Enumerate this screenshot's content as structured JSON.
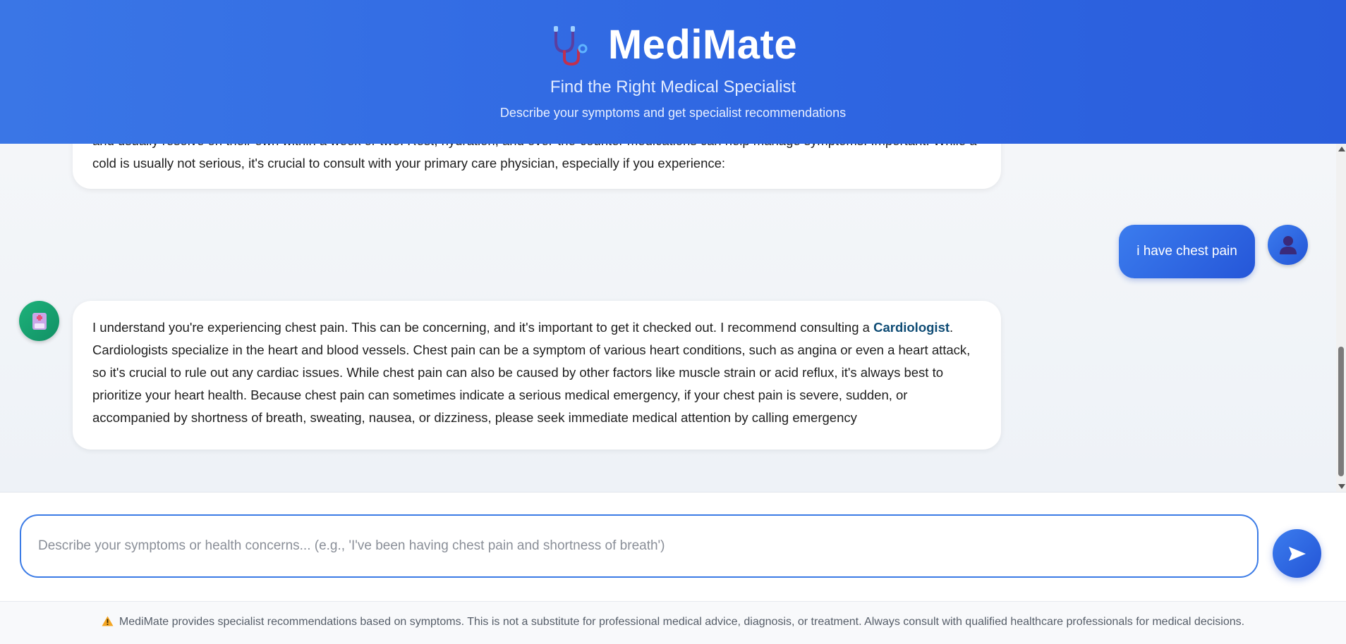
{
  "header": {
    "title": "MediMate",
    "subtitle": "Find the Right Medical Specialist",
    "tagline": "Describe your symptoms and get specialist recommendations"
  },
  "messages": {
    "prev_bot": "and usually resolve on their own within a week or two. Rest, hydration, and over-the-counter medications can help manage symptoms. Important: While a cold is usually not serious, it's crucial to consult with your primary care physician, especially if you experience:",
    "user": "i have chest pain",
    "bot": {
      "before": "I understand you're experiencing chest pain. This can be concerning, and it's important to get it checked out. I recommend consulting a ",
      "specialist": "Cardiologist",
      "after": ". Cardiologists specialize in the heart and blood vessels. Chest pain can be a symptom of various heart conditions, such as angina or even a heart attack, so it's crucial to rule out any cardiac issues. While chest pain can also be caused by other factors like muscle strain or acid reflux, it's always best to prioritize your heart health. Because chest pain can sometimes indicate a serious medical emergency, if your chest pain is severe, sudden, or accompanied by shortness of breath, sweating, nausea, or dizziness, please seek immediate medical attention by calling emergency"
    }
  },
  "input": {
    "placeholder": "Describe your symptoms or health concerns... (e.g., 'I've been having chest pain and shortness of breath')",
    "value": ""
  },
  "footer": {
    "disclaimer": "MediMate provides specialist recommendations based on symptoms. This is not a substitute for professional medical advice, diagnosis, or treatment. Always consult with qualified healthcare professionals for medical decisions."
  },
  "icons": {
    "logo": "stethoscope-icon",
    "bot_avatar": "robot-icon",
    "user_avatar": "user-icon",
    "send": "send-arrow-icon",
    "warning": "warning-icon"
  },
  "colors": {
    "header": "#2f67e2",
    "accent": "#2f6fe6",
    "bot_avatar": "#1aa874",
    "highlight": "#0f4c75"
  }
}
